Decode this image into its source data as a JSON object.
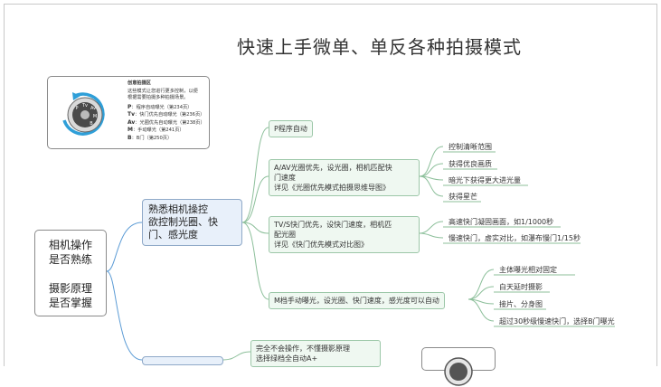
{
  "title": "快速上手微单、单反各种拍摄模式",
  "root": {
    "line1": "相机操作",
    "line2": "是否熟练",
    "line3": "摄影原理",
    "line4": "是否掌握"
  },
  "sub_node": {
    "text": "熟悉相机操控\n欲控制光圈、快\n门、感光度"
  },
  "branches": [
    {
      "text": "P程序自动",
      "leaves": []
    },
    {
      "text": "A/AV光圈优先，设光圈，相机匹配快\n门速度\n详见《光圈优先模式拍摄思维导图》",
      "leaves": [
        "控制清晰范围",
        "获得优良画质",
        "暗光下获得更大进光量",
        "获得星芒"
      ]
    },
    {
      "text": "TV/S快门优先，设快门速度，相机匹\n配光圈\n详见《快门优先模式对比图》",
      "leaves": [
        "高速快门凝固画面，如1/1000秒",
        "慢速快门，虚实对比，如瀑布慢门1/15秒"
      ]
    },
    {
      "text": "M档手动曝光，设光圈、快门速度，感光度可以自动",
      "leaves": [
        "主体曝光相对固定",
        "白天延时摄影",
        "接片、分身图",
        "超过30秒级慢速快门，选择B门曝光"
      ]
    }
  ],
  "bottom_branch": {
    "text": "完全不会操作，不懂摄影原理\n选择绿档全自动A+"
  },
  "note": {
    "heading": "创意拍摄区",
    "desc1": "这些模式让您进行更多控制，以便",
    "desc2": "根据需要拍摄多种拍摄场景。",
    "modes": [
      {
        "key": "P",
        "text": "：程序自动曝光（第234页）"
      },
      {
        "key": "Tv",
        "text": "：快门优先自动曝光（第236页）"
      },
      {
        "key": "Av",
        "text": "：光圈优先自动曝光（第238页）"
      },
      {
        "key": "M",
        "text": "：手动曝光（第241页）"
      },
      {
        "key": "B",
        "text": "：B门（第250页）"
      }
    ],
    "dial_labels": [
      "P",
      "Tv",
      "Av",
      "M",
      "B"
    ]
  },
  "colors": {
    "sub_fill": "#e8f0fa",
    "sub_border": "#8fa9c8",
    "branch_fill": "#eff8f1",
    "branch_border": "#9cc7a8",
    "accent_arc": "#2f9fd8"
  }
}
